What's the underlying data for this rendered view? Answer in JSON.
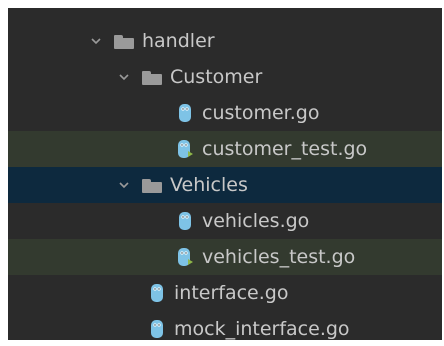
{
  "colors": {
    "background": "#2b2b2b",
    "text": "#c8c8c8",
    "selected_row": "#0d293e",
    "test_row": "#333a2f",
    "folder": "#9a9a9a",
    "gopher": "#7ec3e6"
  },
  "tree": [
    {
      "label": "",
      "type": "partial"
    },
    {
      "label": "handler",
      "type": "folder",
      "expanded": true,
      "icon": "folder-icon"
    },
    {
      "label": "Customer",
      "type": "folder",
      "expanded": true,
      "icon": "folder-icon"
    },
    {
      "label": "customer.go",
      "type": "file",
      "icon": "go-file-icon"
    },
    {
      "label": "customer_test.go",
      "type": "test-file",
      "icon": "go-test-file-icon"
    },
    {
      "label": "Vehicles",
      "type": "folder",
      "expanded": true,
      "selected": true,
      "icon": "folder-icon"
    },
    {
      "label": "vehicles.go",
      "type": "file",
      "icon": "go-file-icon"
    },
    {
      "label": "vehicles_test.go",
      "type": "test-file",
      "icon": "go-test-file-icon"
    },
    {
      "label": "interface.go",
      "type": "file",
      "icon": "go-file-icon"
    },
    {
      "label": "mock_interface.go",
      "type": "file",
      "icon": "go-file-icon"
    }
  ]
}
